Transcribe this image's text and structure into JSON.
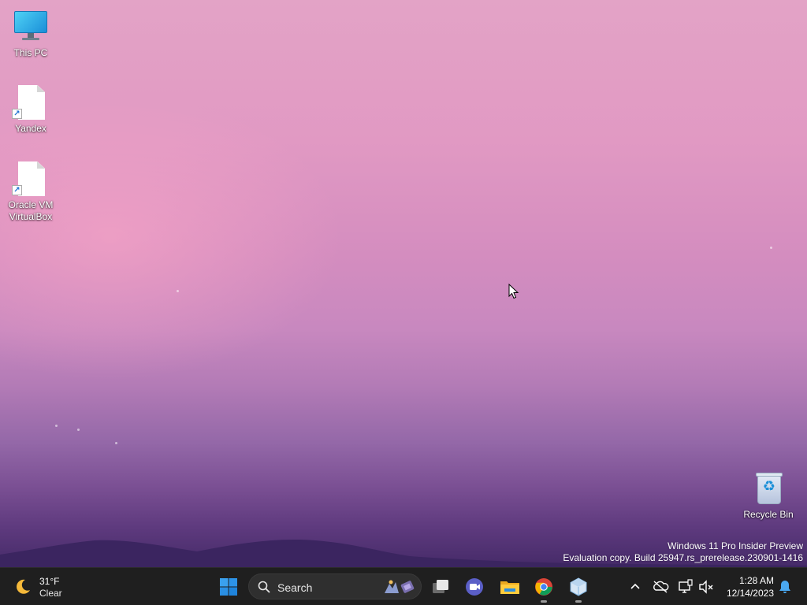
{
  "desktop": {
    "icons": [
      {
        "label": "This PC",
        "icon": "monitor-icon"
      },
      {
        "label": "Yandex",
        "icon": "shortcut-file-icon"
      },
      {
        "label": "Oracle VM VirtualBox",
        "icon": "shortcut-file-icon"
      },
      {
        "label": "Recycle Bin",
        "icon": "recycle-bin-icon"
      }
    ],
    "watermark": {
      "line1": "Windows 11 Pro Insider Preview",
      "line2": "Evaluation copy. Build 25947.rs_prerelease.230901-1416"
    }
  },
  "taskbar": {
    "weather": {
      "temperature": "31°F",
      "condition": "Clear",
      "icon": "moon-icon"
    },
    "search": {
      "placeholder": "Search"
    },
    "apps": [
      {
        "name": "Start",
        "icon": "windows-logo-icon"
      },
      {
        "name": "Task View",
        "icon": "task-view-icon"
      },
      {
        "name": "Meet",
        "icon": "video-chat-icon"
      },
      {
        "name": "File Explorer",
        "icon": "folder-icon"
      },
      {
        "name": "Google Chrome",
        "icon": "chrome-icon",
        "running": true
      },
      {
        "name": "Oracle VM VirtualBox",
        "icon": "virtualbox-icon",
        "running": true
      }
    ],
    "tray": {
      "icons": [
        "chevron-up-icon",
        "onedrive-offline-icon",
        "network-icon",
        "volume-muted-icon"
      ],
      "time": "1:28 AM",
      "date": "12/14/2023",
      "notifications_icon": "bell-icon"
    }
  },
  "colors": {
    "taskbar_bg": "#1f1f1f",
    "accent": "#0a84d6"
  }
}
